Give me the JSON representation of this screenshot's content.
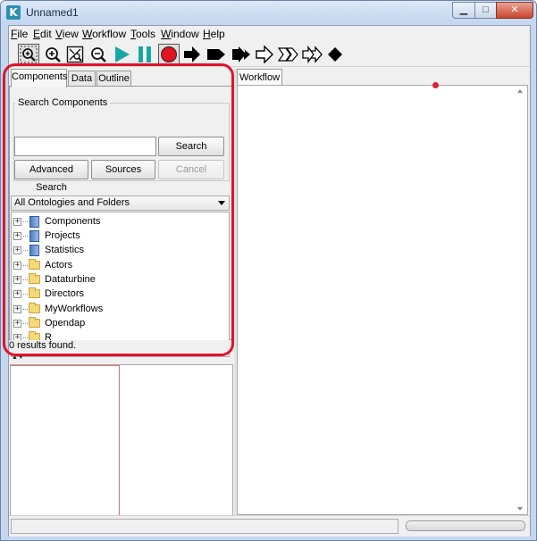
{
  "window": {
    "title": "Unnamed1",
    "app_icon_letter": "K",
    "min_glyph": "▁",
    "max_glyph": "□",
    "close_glyph": "✕"
  },
  "menubar": {
    "items": [
      {
        "pre": "",
        "u": "F",
        "post": "ile"
      },
      {
        "pre": "",
        "u": "E",
        "post": "dit"
      },
      {
        "pre": "",
        "u": "V",
        "post": "iew"
      },
      {
        "pre": "",
        "u": "W",
        "post": "orkflow"
      },
      {
        "pre": "",
        "u": "T",
        "post": "ools"
      },
      {
        "pre": "",
        "u": "W",
        "post": "indow"
      },
      {
        "pre": "",
        "u": "H",
        "post": "elp"
      }
    ]
  },
  "toolbar": {
    "icons": [
      "zoom-reset-icon",
      "zoom-in-icon",
      "zoom-fit-icon",
      "zoom-out-icon",
      "run-icon",
      "pause-icon",
      "stop-icon",
      "arrow-right-icon",
      "flag-icon",
      "double-arrow-icon",
      "outline-arrow-icon",
      "outline-flag-icon",
      "outline-double-arrow-icon",
      "diamond-icon"
    ]
  },
  "left_panel": {
    "tabs": [
      "Components",
      "Data",
      "Outline"
    ],
    "active_tab": "Components",
    "search_group_label": "Search Components",
    "search": {
      "value": "",
      "placeholder": ""
    },
    "search_button": "Search",
    "advanced_search_button": "Advanced Search",
    "sources_button": "Sources",
    "cancel_button": "Cancel",
    "ontology_dropdown": "All Ontologies and Folders",
    "tree_items": [
      {
        "label": "Components",
        "icon": "book-icon"
      },
      {
        "label": "Projects",
        "icon": "book-icon"
      },
      {
        "label": "Statistics",
        "icon": "book-icon"
      },
      {
        "label": "Actors",
        "icon": "folder-icon"
      },
      {
        "label": "Dataturbine",
        "icon": "folder-icon"
      },
      {
        "label": "Directors",
        "icon": "folder-icon"
      },
      {
        "label": "MyWorkflows",
        "icon": "folder-icon"
      },
      {
        "label": "Opendap",
        "icon": "folder-icon"
      },
      {
        "label": "R",
        "icon": "folder-icon"
      }
    ],
    "expander_glyph": "+",
    "status": "0 results found."
  },
  "right_panel": {
    "tab": "Workflow"
  },
  "colors": {
    "highlight": "#e0142c",
    "accent": "#2e8fb0"
  }
}
